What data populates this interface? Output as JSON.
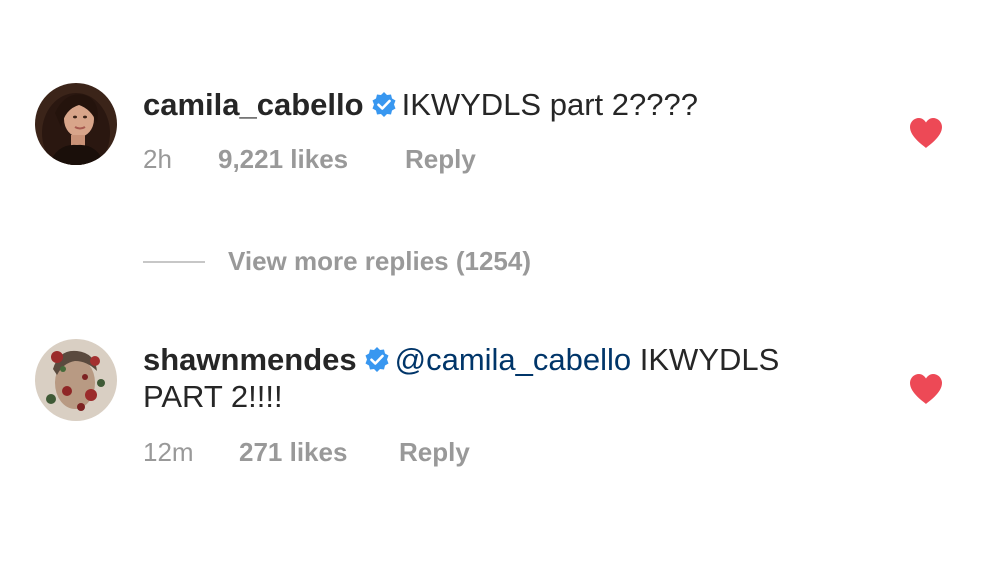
{
  "comments": [
    {
      "username": "camila_cabello",
      "verified": true,
      "text": "IKWYDLS part 2????",
      "time": "2h",
      "likes": "9,221 likes",
      "reply": "Reply",
      "liked": true
    },
    {
      "username": "shawnmendes",
      "verified": true,
      "mention": "@camila_cabello",
      "text_line1": " IKWYDLS",
      "text_line2": "PART 2!!!!",
      "time": "12m",
      "likes": "271 likes",
      "reply": "Reply",
      "liked": true
    }
  ],
  "view_more_replies": "View more replies (1254)",
  "colors": {
    "heart": "#ed4956",
    "verified": "#3897f0",
    "mention": "#003569",
    "meta": "#999999"
  },
  "icons": [
    "verified-badge-icon",
    "heart-icon"
  ]
}
